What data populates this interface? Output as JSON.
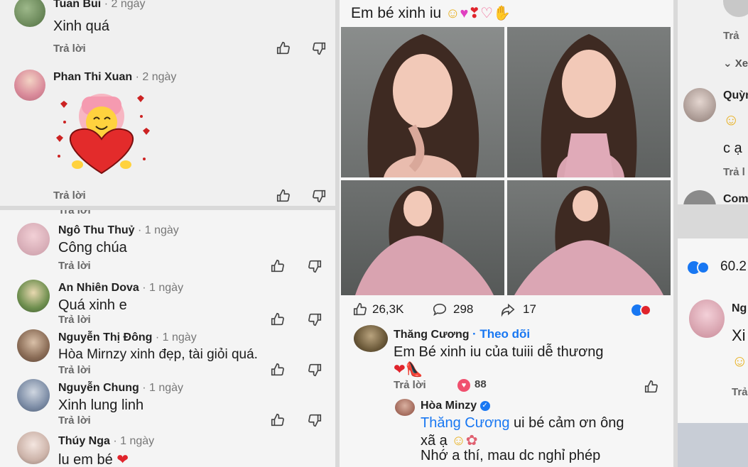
{
  "left_top": {
    "comments": [
      {
        "name": "Tuan Bui",
        "time": "· 2 ngày",
        "text": "Xinh quá",
        "reply": "Trả lời"
      },
      {
        "name": "Phan Thi Xuan",
        "time": "· 2 ngày",
        "reply": "Trả lời",
        "sticker": "heart-hug-sticker"
      }
    ]
  },
  "left_bottom": {
    "cut_reply": "Trả lời",
    "comments": [
      {
        "name": "Ngô Thu Thuỷ",
        "time": "· 1 ngày",
        "text": "Công chúa",
        "reply": "Trả lời"
      },
      {
        "name": "An Nhiên Dova",
        "time": "· 1 ngày",
        "text": "Quá xinh e",
        "reply": "Trả lời"
      },
      {
        "name": "Nguyễn Thị Đông",
        "time": "· 1 ngày",
        "text": "Hòa Mirnzy xinh đẹp, tài giỏi quá.",
        "reply": "Trả lời"
      },
      {
        "name": "Nguyễn Chung",
        "time": "· 1 ngày",
        "text": "Xinh lung linh",
        "reply": "Trả lời"
      },
      {
        "name": "Thúy Nga",
        "time": "· 1 ngày",
        "text": "lu em bé",
        "reply": ""
      }
    ]
  },
  "post": {
    "caption": "Em bé xinh iu",
    "likes": "26,3K",
    "comments": "298",
    "shares": "17",
    "comment1": {
      "name": "Thăng Cương",
      "follow": "· Theo dõi",
      "text": "Em Bé xinh iu của tuiii dễ thương",
      "reply": "Trả lời",
      "reactions": "88"
    },
    "comment2": {
      "name": "Hòa Minzy",
      "mention": "Thăng Cương",
      "text1": " ui bé cảm ơn ông",
      "text2": "xã ạ",
      "text3": "Nhớ a thí, mau dc nghỉ phép"
    }
  },
  "right": {
    "reply1": "Trả",
    "more": "Xe",
    "name1": "Quỳn",
    "text1": "c ạ",
    "reply2": "Trả l",
    "name2": "Com",
    "reactions": "60.2",
    "name3": "Ng",
    "text3": "Xi",
    "reply3": "Trả"
  },
  "colors": {
    "accent_blue": "#1877f2",
    "heart_red": "#e0242c"
  }
}
